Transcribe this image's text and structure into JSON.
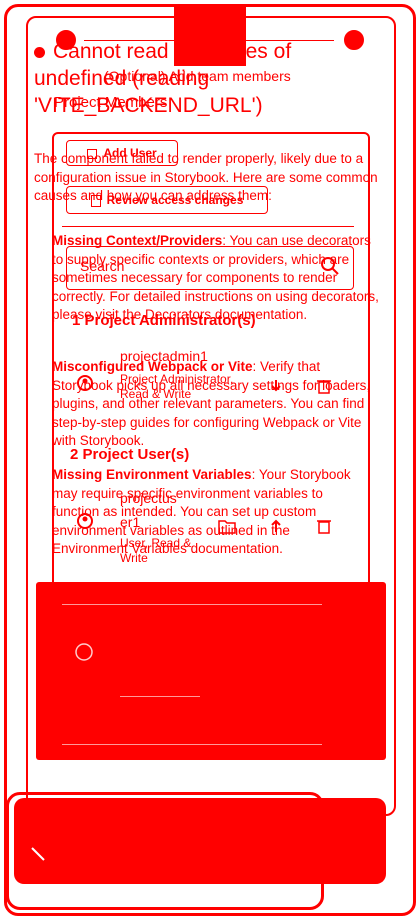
{
  "error": {
    "title": "Cannot read properties of undefined (reading 'VITE_BACKEND_URL')",
    "intro": "The component failed to render properly, likely due to a configuration issue in Storybook. Here are some common causes and how you can address them:",
    "causes": [
      {
        "label": "Missing Context/Providers",
        "text": ": You can use decorators to supply specific contexts or providers, which are sometimes necessary for components to render correctly. For detailed instructions on using decorators, please visit the Decorators documentation."
      },
      {
        "label": "Misconfigured Webpack or Vite",
        "text": ": Verify that Storybook picks up all necessary settings for loaders, plugins, and other relevant parameters. You can find step-by-step guides for configuring Webpack or Vite with Storybook."
      },
      {
        "label": "Missing Environment Variables",
        "text": ": Your Storybook may require specific environment variables to function as intended. You can set up custom environment variables as outlined in the Environment Variables documentation."
      }
    ]
  },
  "panel": {
    "subtitle": "(Optional) Add team members",
    "heading": "Project Members",
    "add_user_label": "Add User",
    "review_label": "Review access changes",
    "search_placeholder": "Search",
    "admins_section": "1 Project Administrator(s)",
    "admin_user": {
      "name": "projectadmin1",
      "role": "Project Administrator, Read & Write"
    },
    "users_section": "2 Project User(s)",
    "project_user": {
      "name": "projectus er1",
      "role": "User, Read & Write"
    }
  },
  "colors": {
    "accent": "#ff0000",
    "background": "#ffffff"
  },
  "icons": [
    "user-plus-icon",
    "list-icon",
    "search-icon",
    "user-circle-icon",
    "download-icon",
    "trash-icon",
    "folder-icon",
    "upload-icon",
    "close-icon",
    "help-icon"
  ]
}
